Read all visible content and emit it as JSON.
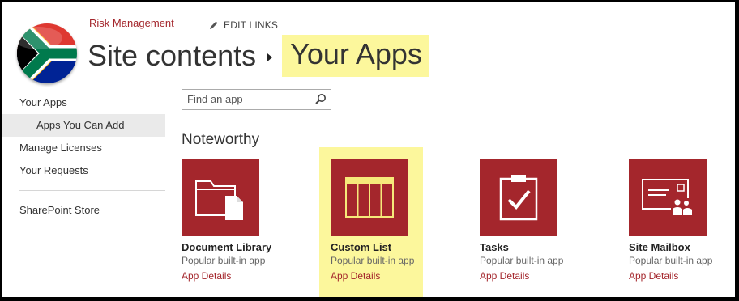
{
  "header": {
    "site_name": "Risk Management",
    "edit_links_label": "EDIT LINKS",
    "title_main": "Site contents",
    "title_current": "Your Apps",
    "highlight_color": "#fcf79c",
    "accent_color": "#a4262c"
  },
  "nav": {
    "items": [
      {
        "label": "Your Apps"
      },
      {
        "label": "Apps You Can Add",
        "selected": true
      },
      {
        "label": "Manage Licenses"
      },
      {
        "label": "Your Requests"
      },
      {
        "label": "SharePoint Store"
      }
    ]
  },
  "search": {
    "placeholder": "Find an app"
  },
  "section": {
    "title": "Noteworthy"
  },
  "apps": [
    {
      "name": "Document Library",
      "description": "Popular built-in app",
      "link": "App Details",
      "icon": "document-library-icon"
    },
    {
      "name": "Custom List",
      "description": "Popular built-in app",
      "link": "App Details",
      "icon": "custom-list-icon",
      "highlighted": true
    },
    {
      "name": "Tasks",
      "description": "Popular built-in app",
      "link": "App Details",
      "icon": "tasks-icon"
    },
    {
      "name": "Site Mailbox",
      "description": "Popular built-in app",
      "link": "App Details",
      "icon": "site-mailbox-icon"
    }
  ]
}
